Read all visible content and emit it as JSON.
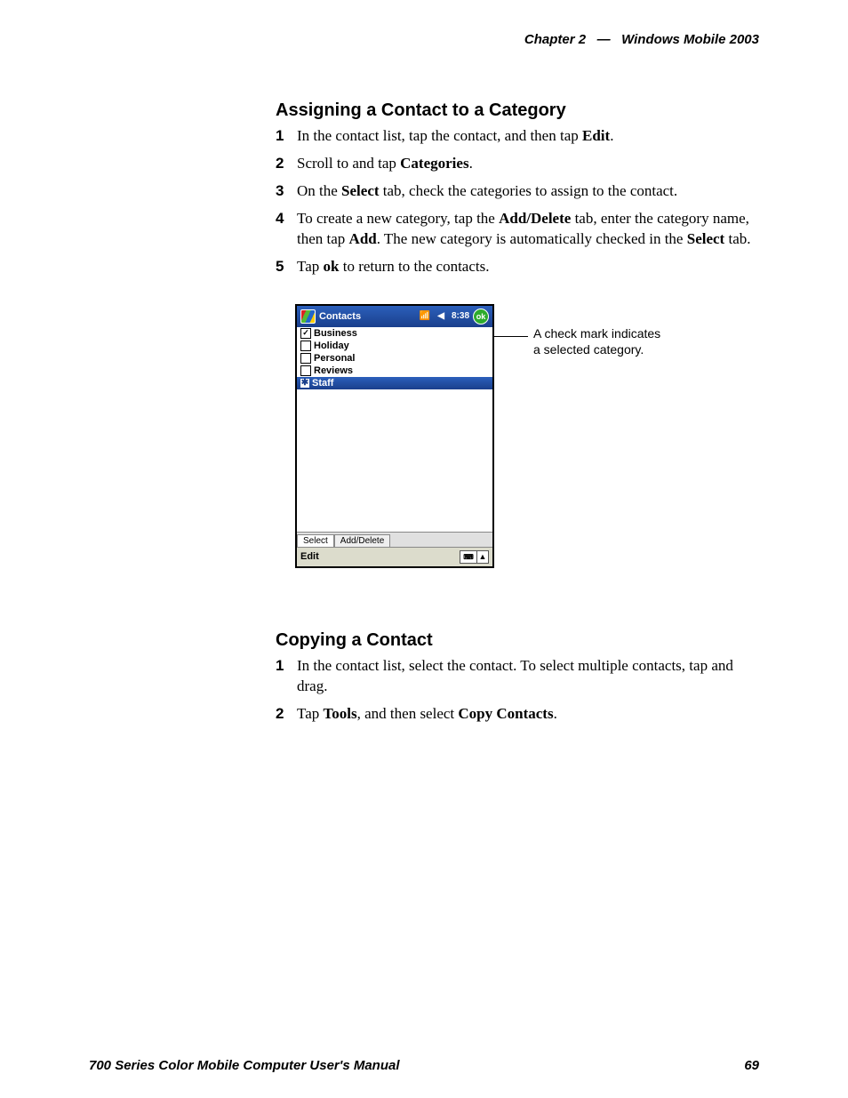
{
  "header": {
    "chapter": "Chapter  2",
    "sep": "—",
    "title": "Windows Mobile 2003"
  },
  "section1": {
    "heading": "Assigning a Contact to a Category",
    "steps": [
      {
        "n": "1",
        "pre": "In the contact list, tap the contact, and then tap ",
        "b1": "Edit",
        "mid": "",
        "post": "."
      },
      {
        "n": "2",
        "pre": "Scroll to and tap ",
        "b1": "Categories",
        "mid": "",
        "post": "."
      },
      {
        "n": "3",
        "pre": "On the ",
        "b1": "Select",
        "mid": " tab, check the categories to assign to the contact.",
        "post": ""
      },
      {
        "n": "4",
        "pre": "To create a new category, tap the ",
        "b1": "Add/Delete",
        "mid": " tab, enter the category name, then tap ",
        "b2": "Add",
        "mid2": ". The new category is automatically checked in the ",
        "b3": "Select",
        "post": " tab."
      },
      {
        "n": "5",
        "pre": "Tap ",
        "b1": "ok",
        "mid": " to return to the contacts.",
        "post": ""
      }
    ]
  },
  "device": {
    "title": "Contacts",
    "time": "8:38",
    "ok": "ok",
    "categories": [
      {
        "label": "Business",
        "checked": true,
        "selected": false
      },
      {
        "label": "Holiday",
        "checked": false,
        "selected": false
      },
      {
        "label": "Personal",
        "checked": false,
        "selected": false
      },
      {
        "label": "Reviews",
        "checked": false,
        "selected": false
      },
      {
        "label": "Staff",
        "checked": false,
        "selected": true
      }
    ],
    "tabs": {
      "select": "Select",
      "adddelete": "Add/Delete"
    },
    "bottombar": {
      "edit": "Edit"
    }
  },
  "callout": {
    "line1": "A check mark indicates",
    "line2": "a selected category."
  },
  "section2": {
    "heading": "Copying a Contact",
    "steps": [
      {
        "n": "1",
        "pre": "In the contact list, select the contact. To select multiple contacts, tap and drag.",
        "b1": "",
        "mid": "",
        "post": ""
      },
      {
        "n": "2",
        "pre": "Tap ",
        "b1": "Tools",
        "mid": ", and then select ",
        "b2": "Copy Contacts",
        "post": "."
      }
    ]
  },
  "footer": {
    "left": "700 Series Color Mobile Computer User's Manual",
    "right": "69"
  }
}
